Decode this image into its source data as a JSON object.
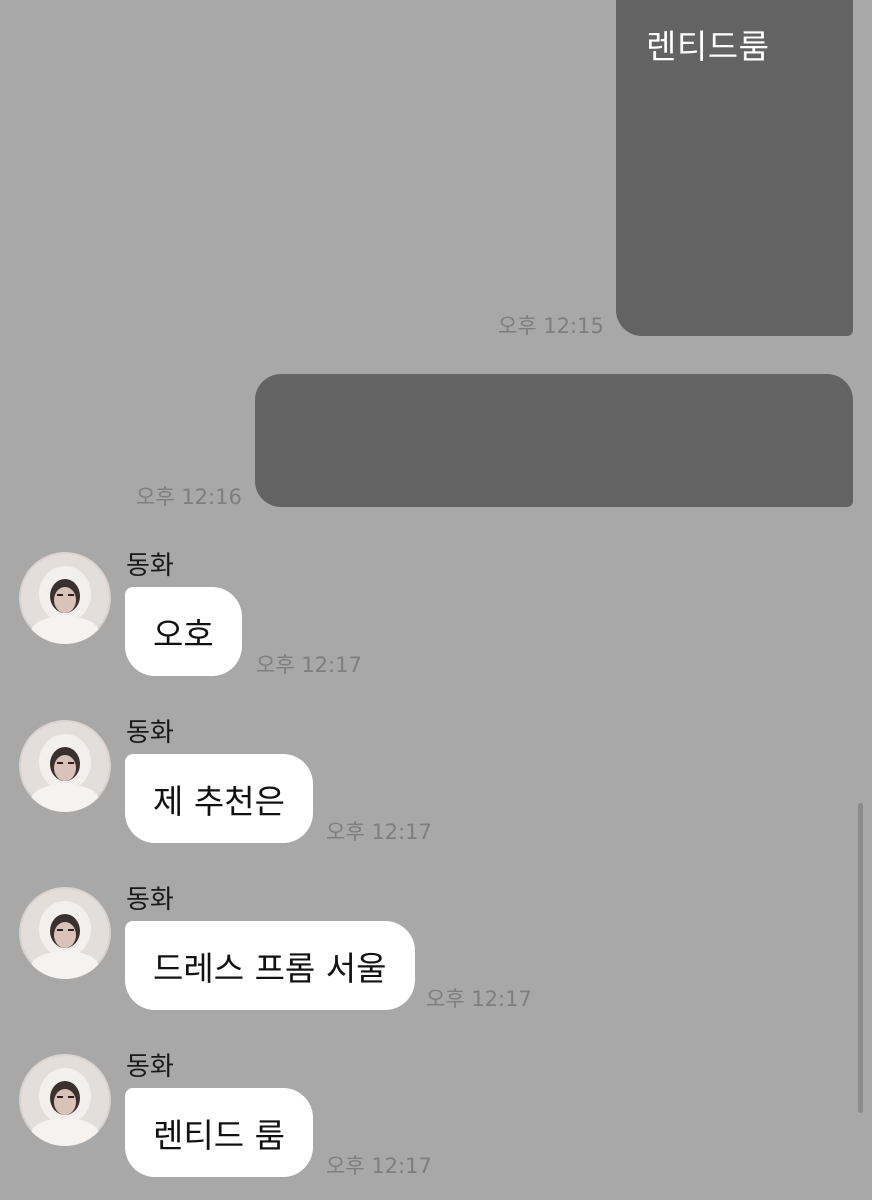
{
  "sent_messages": [
    {
      "text": "렌티드룸",
      "time": "오후 12:15"
    },
    {
      "text": "",
      "time": "오후 12:16"
    }
  ],
  "received_messages": [
    {
      "sender": "동화",
      "text": "오호",
      "time": "오후 12:17"
    },
    {
      "sender": "동화",
      "text": "제 추천은",
      "time": "오후 12:17"
    },
    {
      "sender": "동화",
      "text": "드레스 프롬 서울",
      "time": "오후 12:17"
    },
    {
      "sender": "동화",
      "text": "렌티드 룸",
      "time": "오후 12:17"
    }
  ],
  "colors": {
    "background": "#a8a8a8",
    "sent_bubble": "#636363",
    "received_bubble": "#ffffff",
    "timestamp": "#7e7e7e"
  },
  "icons": {
    "avatar": "profile-photo-avatar"
  }
}
